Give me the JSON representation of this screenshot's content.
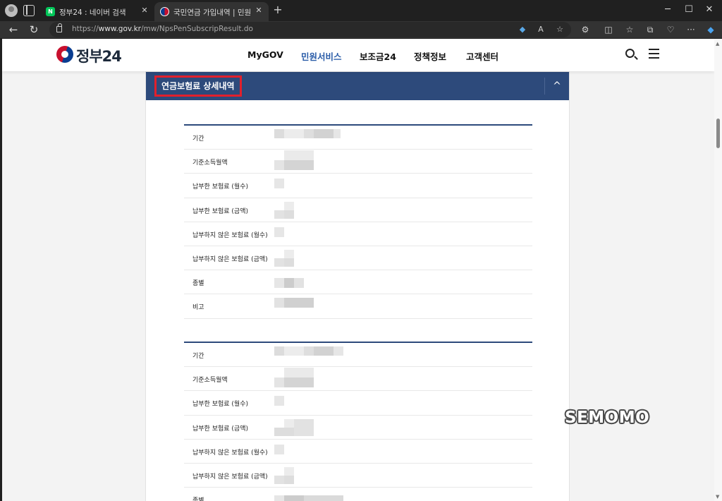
{
  "browser": {
    "tabs": [
      {
        "title": "정부24 : 네이버 검색",
        "favicon": "naver-icon",
        "active": false
      },
      {
        "title": "국민연금 가입내역 | 민원서비스 |",
        "favicon": "gov24-icon",
        "active": true
      }
    ],
    "url_prefix": "https://",
    "url_host": "www.gov.kr",
    "url_path": "/mw/NpsPenSubscripResult.do",
    "window_controls": {
      "minimize": "─",
      "maximize": "☐",
      "close": "✕"
    }
  },
  "site": {
    "logo_text": "정부24",
    "nav": [
      {
        "label": "MyGOV",
        "active": false
      },
      {
        "label": "민원서비스",
        "active": true
      },
      {
        "label": "보조금24",
        "active": false
      },
      {
        "label": "정책정보",
        "active": false
      },
      {
        "label": "고객센터",
        "active": false
      }
    ]
  },
  "section": {
    "title": "연금보험료 상세내역",
    "collapse_symbol": "^"
  },
  "records": [
    {
      "rows": [
        {
          "label": "기간"
        },
        {
          "label": "기준소득월액"
        },
        {
          "label": "납부한 보험료 (월수)"
        },
        {
          "label": "납부한 보험료 (금액)"
        },
        {
          "label": "납부하지 않은 보험료 (월수)"
        },
        {
          "label": "납부하지 않은 보험료 (금액)"
        },
        {
          "label": "종별"
        },
        {
          "label": "비고"
        }
      ]
    },
    {
      "rows": [
        {
          "label": "기간"
        },
        {
          "label": "기준소득월액"
        },
        {
          "label": "납부한 보험료 (월수)"
        },
        {
          "label": "납부한 보험료 (금액)"
        },
        {
          "label": "납부하지 않은 보험료 (월수)"
        },
        {
          "label": "납부하지 않은 보험료 (금액)"
        },
        {
          "label": "종별"
        }
      ]
    }
  ],
  "watermark": "SEMOMO",
  "colors": {
    "header_bar": "#2d4a7b",
    "highlight_box": "#e2202c",
    "nav_active": "#2a5ca8"
  }
}
